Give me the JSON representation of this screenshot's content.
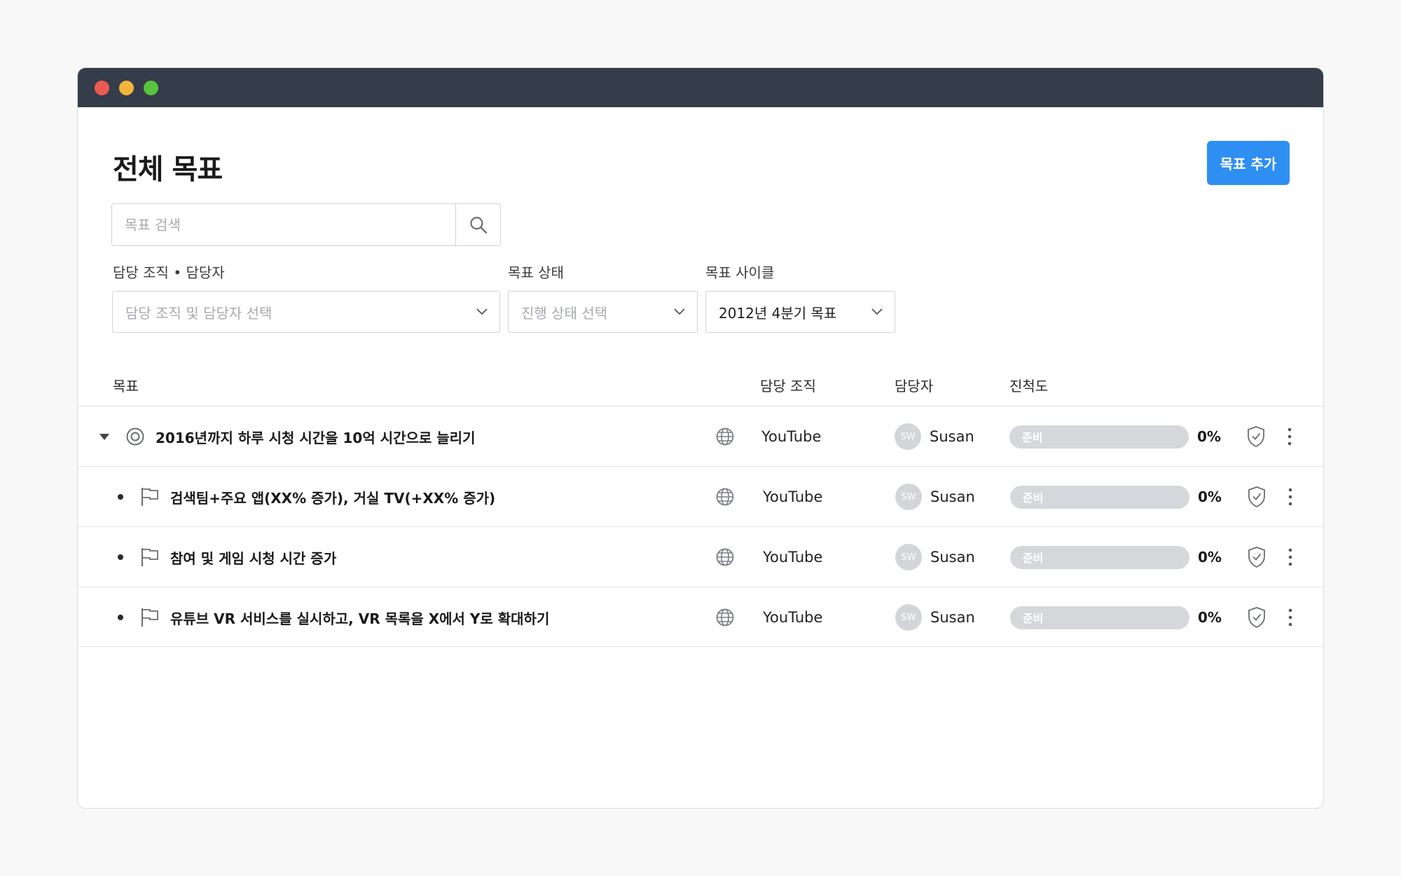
{
  "window": {
    "controls": [
      "close",
      "minimize",
      "maximize"
    ]
  },
  "header": {
    "title": "전체 목표",
    "add_button_label": "목표 추가"
  },
  "search": {
    "placeholder": "목표 검색",
    "value": ""
  },
  "filters": {
    "owner": {
      "label": "담당 조직 • 담당자",
      "placeholder": "담당 조직 및 담당자 선택",
      "value": ""
    },
    "status": {
      "label": "목표 상태",
      "placeholder": "진행 상태 선택",
      "value": ""
    },
    "cycle": {
      "label": "목표 사이클",
      "value": "2012년 4분기 목표"
    }
  },
  "table": {
    "columns": {
      "goal": "목표",
      "org": "담당 조직",
      "owner": "담당자",
      "progress": "진척도"
    },
    "rows": [
      {
        "type": "objective",
        "expanded": true,
        "title": "2016년까지 하루 시청 시간을 10억 시간으로 늘리기",
        "visibility_icon": "globe-icon",
        "org": "YouTube",
        "owner_initials": "SW",
        "owner": "Susan",
        "status": "준비",
        "progress": 0,
        "progress_text": "0%"
      },
      {
        "type": "key-result",
        "title": "검색팀+주요 앱(XX% 증가), 거실 TV(+XX% 증가)",
        "visibility_icon": "globe-icon",
        "org": "YouTube",
        "owner_initials": "SW",
        "owner": "Susan",
        "status": "준비",
        "progress": 0,
        "progress_text": "0%"
      },
      {
        "type": "key-result",
        "title": "참여 및 게임 시청 시간 증가",
        "visibility_icon": "globe-icon",
        "org": "YouTube",
        "owner_initials": "SW",
        "owner": "Susan",
        "status": "준비",
        "progress": 0,
        "progress_text": "0%"
      },
      {
        "type": "key-result",
        "title": "유튜브 VR 서비스를 실시하고, VR 목록을 X에서 Y로 확대하기",
        "visibility_icon": "globe-icon",
        "org": "YouTube",
        "owner_initials": "SW",
        "owner": "Susan",
        "status": "준비",
        "progress": 0,
        "progress_text": "0%"
      }
    ]
  },
  "colors": {
    "titlebar": "#343d49",
    "accent": "#2f8ef2",
    "progress_track": "#d6d7da",
    "avatar": "#d4d5d8"
  }
}
